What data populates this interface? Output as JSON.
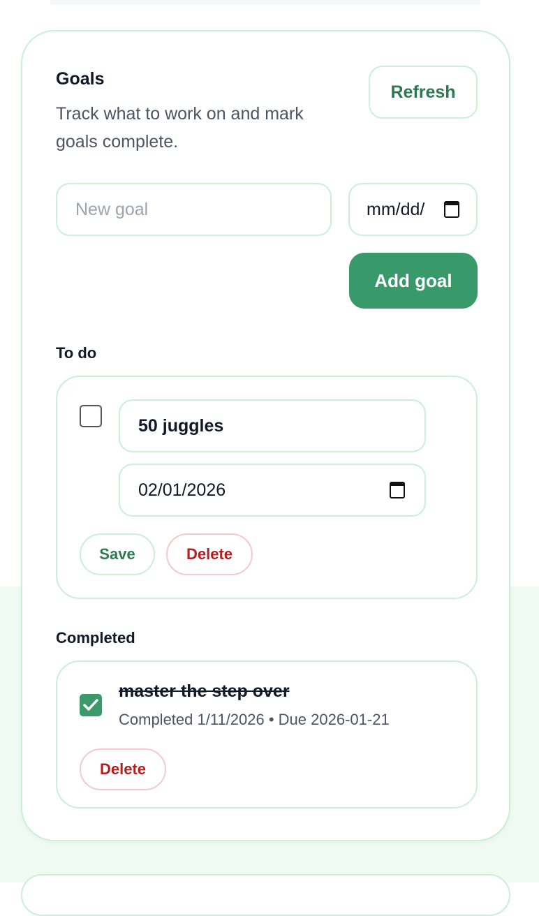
{
  "goals": {
    "title": "Goals",
    "description": "Track what to work on and mark goals complete.",
    "refresh_label": "Refresh",
    "new_goal_placeholder": "New goal",
    "new_goal_date_placeholder": "mm/dd/",
    "add_goal_label": "Add goal"
  },
  "todo": {
    "heading": "To do",
    "items": [
      {
        "title": "50 juggles",
        "due_date": "02/01/2026",
        "checked": false,
        "save_label": "Save",
        "delete_label": "Delete"
      }
    ]
  },
  "completed": {
    "heading": "Completed",
    "items": [
      {
        "title": "master the step over",
        "meta": "Completed 1/11/2026 • Due 2026-01-21",
        "checked": true,
        "delete_label": "Delete"
      }
    ]
  },
  "colors": {
    "accent": "#38996a",
    "border": "#c9f0d6",
    "danger": "#b91c1c",
    "background_tint": "#eefaf2"
  }
}
